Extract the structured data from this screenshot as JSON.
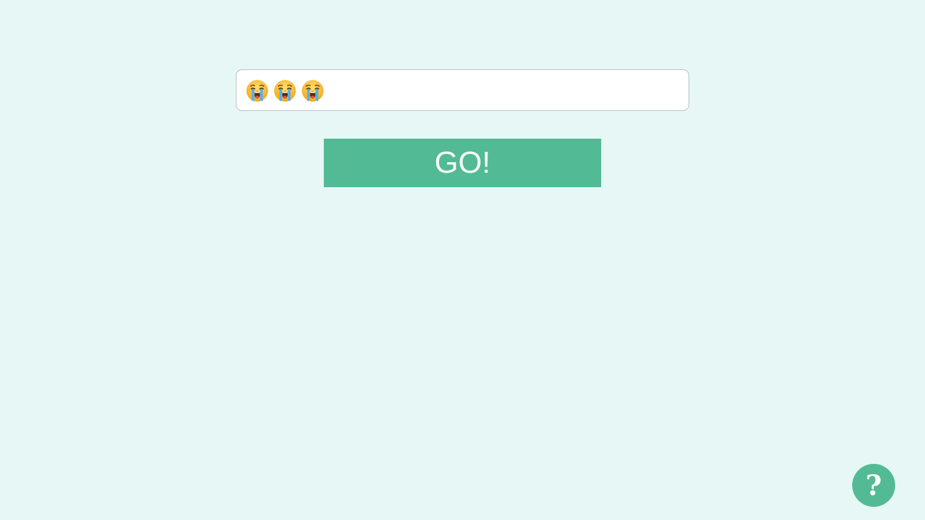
{
  "colors": {
    "background": "#e6f7f6",
    "accent": "#52bb96",
    "input_background": "#ffffff",
    "input_border": "#b9c3c3",
    "button_text": "#ffffff"
  },
  "input": {
    "value": "😭😭😭",
    "emoji_icon_names": [
      "loudly-crying-face-icon",
      "loudly-crying-face-icon",
      "loudly-crying-face-icon"
    ]
  },
  "go_button": {
    "label": "GO!"
  },
  "help_button": {
    "label": "?",
    "icon": "question-mark-icon"
  }
}
